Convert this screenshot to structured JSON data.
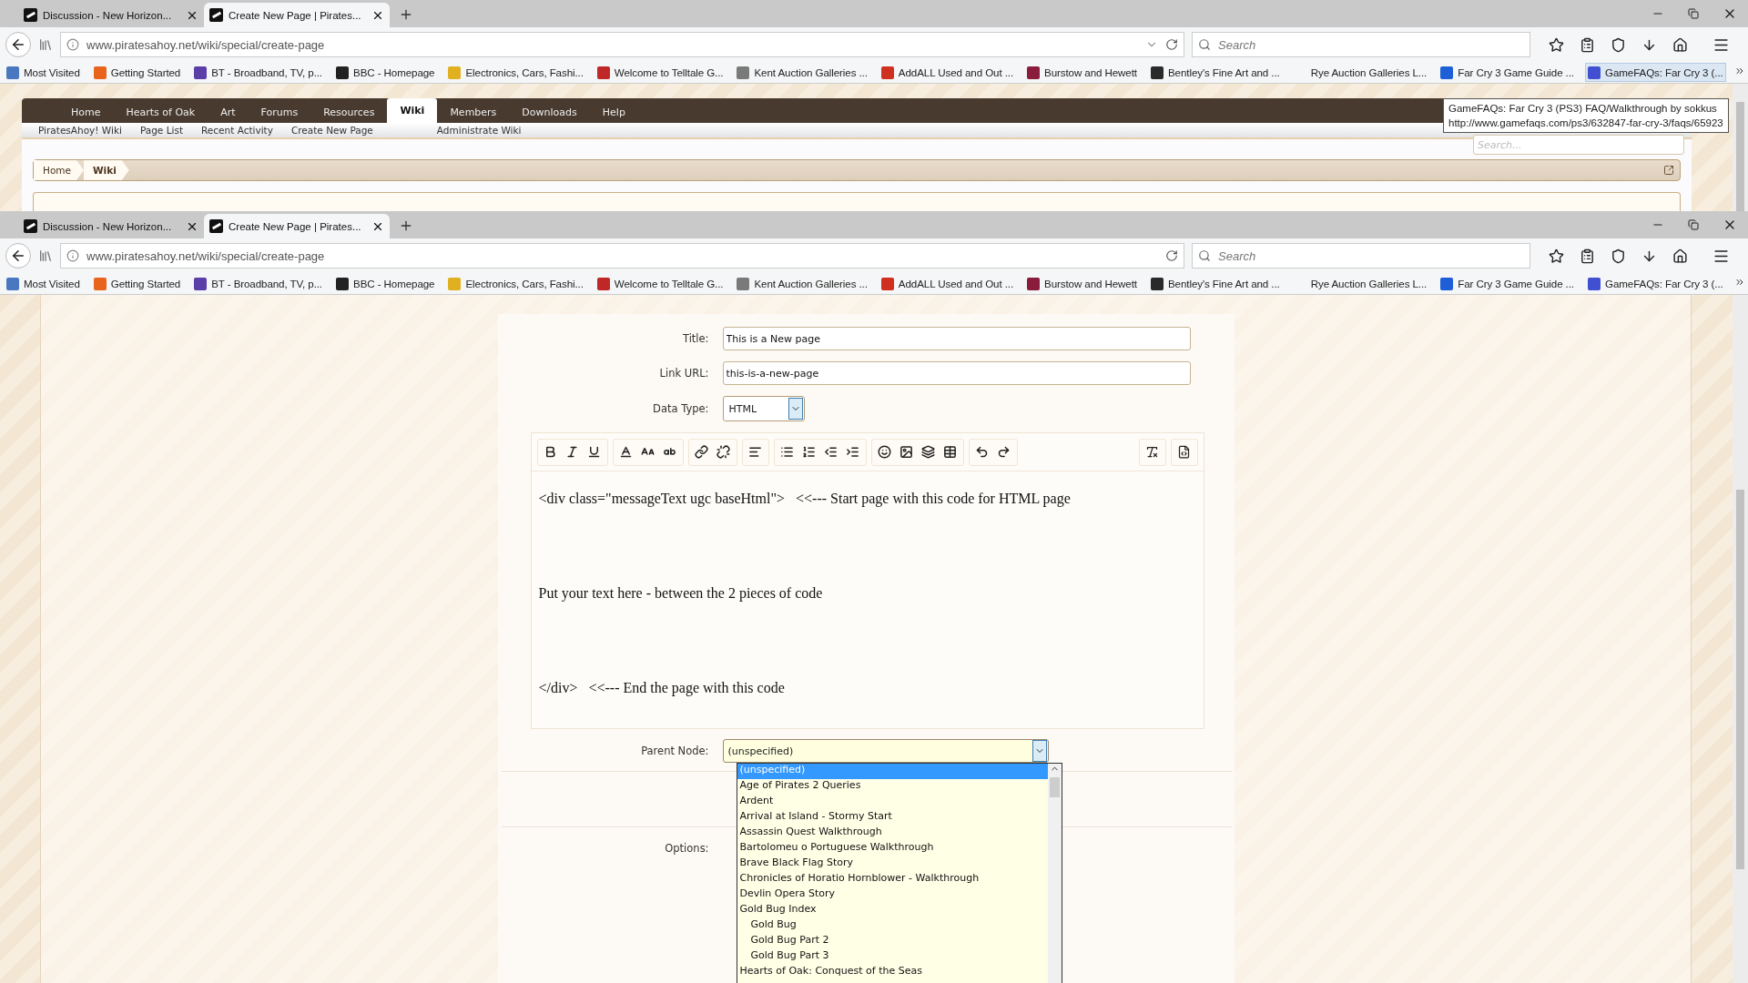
{
  "back_window": {
    "tabs": [
      {
        "title": "Discussion - New Horizon...",
        "selected": false
      },
      {
        "title": "Create New Page | Pirates...",
        "selected": true
      }
    ],
    "address": "www.piratesahoy.net/wiki/special/create-page",
    "history_dropdown": true,
    "search_placeholder": "Search",
    "bookmarks": [
      {
        "label": "Most Visited",
        "color": "#4a78c0",
        "hovered": false
      },
      {
        "label": "Getting Started",
        "color": "#e8641c",
        "hovered": false
      },
      {
        "label": "BT - Broadband, TV, p...",
        "color": "#5a3fa8",
        "hovered": false
      },
      {
        "label": "BBC - Homepage",
        "color": "#222222",
        "hovered": false
      },
      {
        "label": "Electronics, Cars, Fashi...",
        "color": "#e0b020",
        "hovered": false
      },
      {
        "label": "Welcome to Telltale G...",
        "color": "#c02828",
        "hovered": false
      },
      {
        "label": "Kent Auction Galleries ...",
        "color": "#7a7a7a",
        "hovered": false
      },
      {
        "label": "AddALL Used and Out ...",
        "color": "#d03020",
        "hovered": false
      },
      {
        "label": "Burstow and Hewett",
        "color": "#8a1c3c",
        "hovered": false
      },
      {
        "label": "Bentley's Fine Art and ...",
        "color": "#2a2a2a",
        "hovered": false
      },
      {
        "label": "Rye Auction Galleries L...",
        "hovered": false
      },
      {
        "label": "Far Cry 3 Game Guide ...",
        "color": "#1e5fd8",
        "hovered": false
      },
      {
        "label": "GameFAQs: Far Cry 3 (...",
        "color": "#4050d0",
        "hovered": true
      }
    ],
    "site_nav": [
      {
        "label": "Home",
        "selected": false
      },
      {
        "label": "Hearts of Oak",
        "selected": false
      },
      {
        "label": "Art",
        "selected": false
      },
      {
        "label": "Forums",
        "selected": false
      },
      {
        "label": "Resources",
        "selected": false
      },
      {
        "label": "Wiki",
        "selected": true
      },
      {
        "label": "Members",
        "selected": false
      },
      {
        "label": "Downloads",
        "selected": false
      },
      {
        "label": "Help",
        "selected": false
      }
    ],
    "sub_nav": [
      "PiratesAhoy! Wiki",
      "Page List",
      "Recent Activity",
      "Create New Page",
      "Administrate Wiki"
    ],
    "site_search_placeholder": "Search...",
    "breadcrumb": [
      "Home",
      "Wiki"
    ],
    "tooltip": [
      "GameFAQs: Far Cry 3 (PS3) FAQ/Walkthrough by sokkus",
      "http://www.gamefaqs.com/ps3/632847-far-cry-3/faqs/65923"
    ]
  },
  "front_window": {
    "tabs": [
      {
        "title": "Discussion - New Horizon...",
        "selected": false
      },
      {
        "title": "Create New Page | Pirates...",
        "selected": true
      }
    ],
    "address": "www.piratesahoy.net/wiki/special/create-page",
    "history_dropdown": false,
    "search_placeholder": "Search",
    "bookmarks": [
      {
        "label": "Most Visited",
        "color": "#4a78c0",
        "hovered": false
      },
      {
        "label": "Getting Started",
        "color": "#e8641c",
        "hovered": false
      },
      {
        "label": "BT - Broadband, TV, p...",
        "color": "#5a3fa8",
        "hovered": false
      },
      {
        "label": "BBC - Homepage",
        "color": "#222222",
        "hovered": false
      },
      {
        "label": "Electronics, Cars, Fashi...",
        "color": "#e0b020",
        "hovered": false
      },
      {
        "label": "Welcome to Telltale G...",
        "color": "#c02828",
        "hovered": false
      },
      {
        "label": "Kent Auction Galleries ...",
        "color": "#7a7a7a",
        "hovered": false
      },
      {
        "label": "AddALL Used and Out ...",
        "color": "#d03020",
        "hovered": false
      },
      {
        "label": "Burstow and Hewett",
        "color": "#8a1c3c",
        "hovered": false
      },
      {
        "label": "Bentley's Fine Art and ...",
        "color": "#2a2a2a",
        "hovered": false
      },
      {
        "label": "Rye Auction Galleries L...",
        "hovered": false
      },
      {
        "label": "Far Cry 3 Game Guide ...",
        "color": "#1e5fd8",
        "hovered": false
      },
      {
        "label": "GameFAQs: Far Cry 3 (...",
        "color": "#4050d0",
        "hovered": false
      }
    ],
    "form": {
      "fields": [
        {
          "label": "Title:",
          "value": "This is a New page",
          "kind": "text"
        },
        {
          "label": "Link URL:",
          "value": "this-is-a-new-page",
          "kind": "text"
        },
        {
          "label": "Data Type:",
          "value": "HTML",
          "kind": "select"
        }
      ],
      "editor_lines": [
        "<div class=\"messageText ugc baseHtml\">   <<--- Start page with this code for HTML page",
        "Put your text here - between the 2 pieces of code",
        "</div>   <<--- End the page with this code"
      ],
      "parent_node": {
        "label": "Parent Node:",
        "value": "(unspecified)",
        "options": [
          {
            "label": "(unspecified)",
            "selected": true
          },
          {
            "label": "Age of Pirates 2 Queries",
            "selected": false
          },
          {
            "label": "Ardent",
            "selected": false
          },
          {
            "label": "Arrival at Island - Stormy Start",
            "selected": false
          },
          {
            "label": "Assassin Quest Walkthrough",
            "selected": false
          },
          {
            "label": "Bartolomeu o Portuguese Walkthrough",
            "selected": false
          },
          {
            "label": "Brave Black Flag Story",
            "selected": false
          },
          {
            "label": "Chronicles of Horatio Hornblower - Walkthrough",
            "selected": false
          },
          {
            "label": "Devlin Opera Story",
            "selected": false
          },
          {
            "label": "Gold Bug Index",
            "selected": false,
            "children": [
              {
                "label": "Gold Bug",
                "selected": false
              },
              {
                "label": "Gold Bug Part 2",
                "selected": false
              },
              {
                "label": "Gold Bug Part 3",
                "selected": false
              }
            ]
          },
          {
            "label": "Hearts of Oak: Conquest of the Seas",
            "selected": false
          }
        ]
      },
      "options_label": "Options:"
    }
  }
}
